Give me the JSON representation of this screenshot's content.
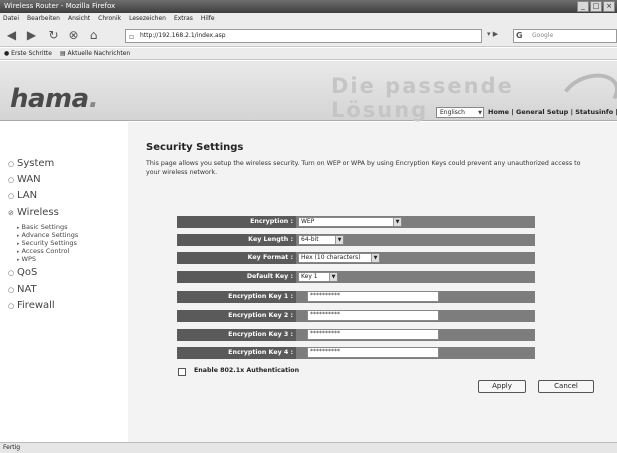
{
  "browser": {
    "title": "Wireless Router - Mozilla Firefox",
    "menu": [
      "Datei",
      "Bearbeiten",
      "Ansicht",
      "Chronik",
      "Lesezeichen",
      "Extras",
      "Hilfe"
    ],
    "url": "http://192.168.2.1/index.asp",
    "search_placeholder": "Google",
    "bookmarks": [
      "Erste Schritte",
      "Aktuelle Nachrichten"
    ],
    "status": "Fertig"
  },
  "header": {
    "logo": "hama",
    "logo_dot": ".",
    "slogan": "Die passende Lösung",
    "language": "Englisch",
    "top_links": "Home | General Setup | Statusinfo | Too"
  },
  "sidebar": {
    "items": [
      "System",
      "WAN",
      "LAN",
      "Wireless",
      "QoS",
      "NAT",
      "Firewall"
    ],
    "wireless_sub": [
      "Basic Settings",
      "Advance Settings",
      "Security Settings",
      "Access Control",
      "WPS"
    ]
  },
  "main": {
    "title": "Security Settings",
    "description": "This page allows you setup the wireless security. Turn on WEP or WPA by using Encryption Keys could prevent any unauthorized access to your wireless network.",
    "fields": {
      "encryption": {
        "label": "Encryption :",
        "value": "WEP"
      },
      "key_length": {
        "label": "Key Length :",
        "value": "64-bit"
      },
      "key_format": {
        "label": "Key Format :",
        "value": "Hex (10 characters)"
      },
      "default_key": {
        "label": "Default Key :",
        "value": "Key 1"
      },
      "key1": {
        "label": "Encryption Key 1 :",
        "value": "**********"
      },
      "key2": {
        "label": "Encryption Key 2 :",
        "value": "**********"
      },
      "key3": {
        "label": "Encryption Key 3 :",
        "value": "**********"
      },
      "key4": {
        "label": "Encryption Key 4 :",
        "value": "**********"
      }
    },
    "auth_label": "Enable 802.1x Authentication",
    "apply": "Apply",
    "cancel": "Cancel"
  }
}
